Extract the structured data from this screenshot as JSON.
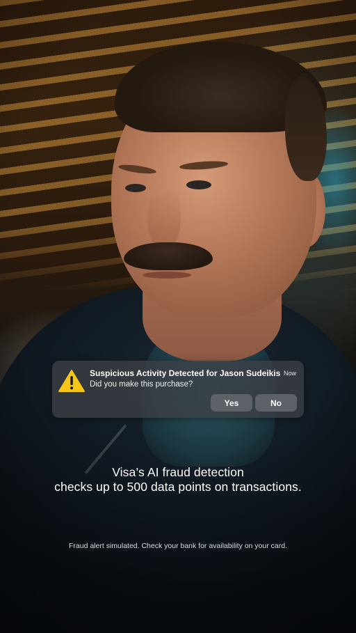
{
  "notification": {
    "icon": "warning-icon",
    "title": "Suspicious Activity Detected for Jason Sudeikis",
    "time": "Now",
    "body": "Did you make this purchase?",
    "yes_label": "Yes",
    "no_label": "No"
  },
  "captions": {
    "line1": "Visa’s AI fraud detection",
    "line2": "checks up to 500 data points on transactions."
  },
  "disclaimer": "Fraud alert simulated. Check your bank for availability on your card.",
  "colors": {
    "warning": "#f5c518",
    "notification_bg": "#3a3e44",
    "button_bg": "#5f636a",
    "text": "#ffffff"
  }
}
